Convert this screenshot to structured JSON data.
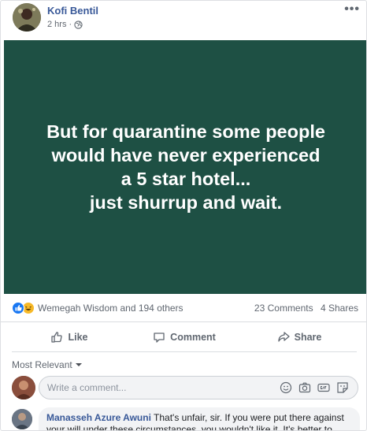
{
  "post": {
    "author": "Kofi Bentil",
    "time": "2 hrs",
    "separator": "·",
    "more_label": "•••",
    "banner": {
      "lines": [
        "But for quarantine some people",
        "would have never experienced",
        "a 5 star hotel...",
        "just shurrup and wait."
      ],
      "bg_color": "#1e5044",
      "text_color": "#ffffff"
    }
  },
  "stats": {
    "reactors": "Wemegah Wisdom and 194 others",
    "comments": "23 Comments",
    "shares": "4 Shares",
    "reaction_icons": [
      "like-icon",
      "haha-icon"
    ]
  },
  "actions": {
    "like": "Like",
    "comment": "Comment",
    "share": "Share"
  },
  "comments_section": {
    "sort_label": "Most Relevant",
    "input_placeholder": "Write a comment...",
    "compose_icons": [
      "emoji-icon",
      "camera-icon",
      "gif-icon",
      "sticker-icon"
    ],
    "comments": [
      {
        "name": "Manasseh Azure Awuni",
        "text": "That's unfair, sir. If you were put there against your will under these circumstances, you wouldn't like it. It's better to"
      }
    ]
  },
  "colors": {
    "link": "#385898",
    "muted": "#606770",
    "accent": "#1877f2"
  }
}
